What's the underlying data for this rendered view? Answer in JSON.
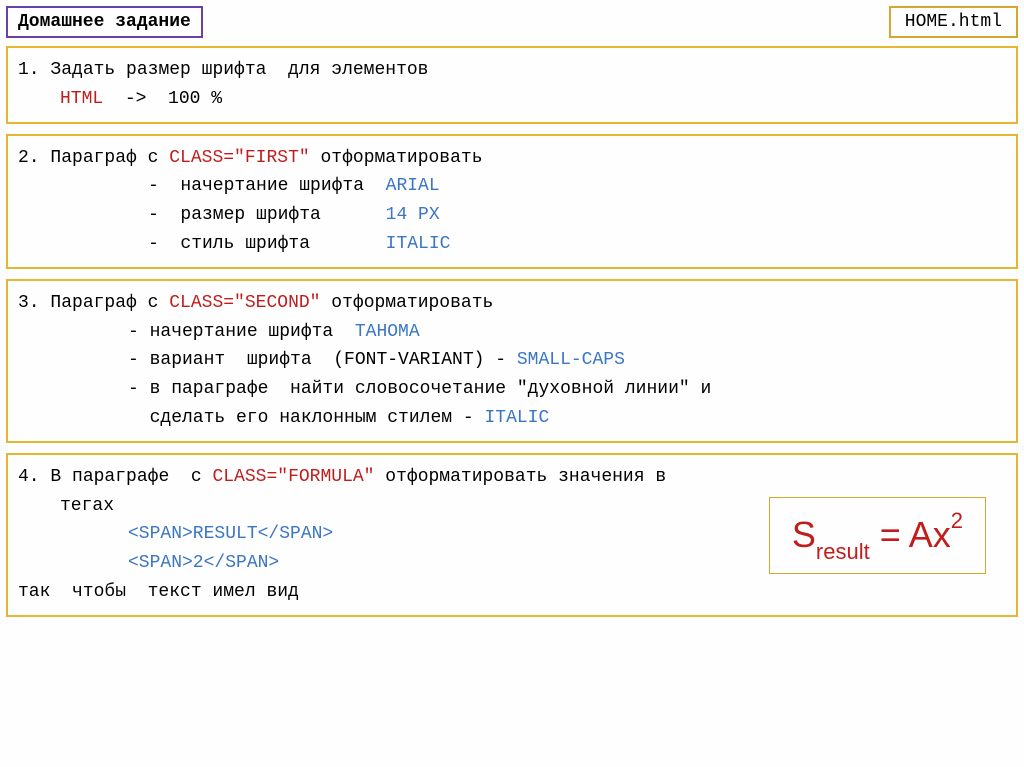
{
  "header": {
    "title": "Домашнее задание",
    "filename": "HOME.html"
  },
  "task1": {
    "num": "1.",
    "text1": "Задать размер шрифта  для элементов",
    "html_kw": "HTML",
    "arrow": "  ->  ",
    "percent": "100 %"
  },
  "task2": {
    "num": "2.",
    "text1": "Параграф с ",
    "class_kw": "CLASS=\"FIRST\"",
    "text2": " отформатировать",
    "line2a": "-  начертание шрифта  ",
    "line2a_val": "ARIAL",
    "line2b": "-  размер шрифта      ",
    "line2b_val": "14 PX",
    "line2c": "-  стиль шрифта       ",
    "line2c_val": "ITALIC"
  },
  "task3": {
    "num": "3.",
    "text1": "Параграф с ",
    "class_kw": "CLASS=\"SECOND\"",
    "text2": " отформатировать",
    "line3a": "- начертание шрифта  ",
    "line3a_val": "TAHOMA",
    "line3b": "- вариант  шрифта  (FONT-VARIANT) - ",
    "line3b_val": "SMALL-CAPS",
    "line3c": "- в параграфе  найти словосочетание \"духовной линии\" и",
    "line3d": "  сделать его наклонным стилем - ",
    "line3d_val": "ITALIC"
  },
  "task4": {
    "num": "4.",
    "text1": "В параграфе  с ",
    "class_kw": "CLASS=\"FORMULA\"",
    "text2": " отформатировать значения в",
    "text3": "тегах",
    "span1": "<SPAN>RESULT</SPAN>",
    "span2": "<SPAN>2</SPAN>",
    "text4": "так  чтобы  текст имел вид",
    "formula_S": "S",
    "formula_sub": "result",
    "formula_eq": " = Ax",
    "formula_sup": "2"
  }
}
